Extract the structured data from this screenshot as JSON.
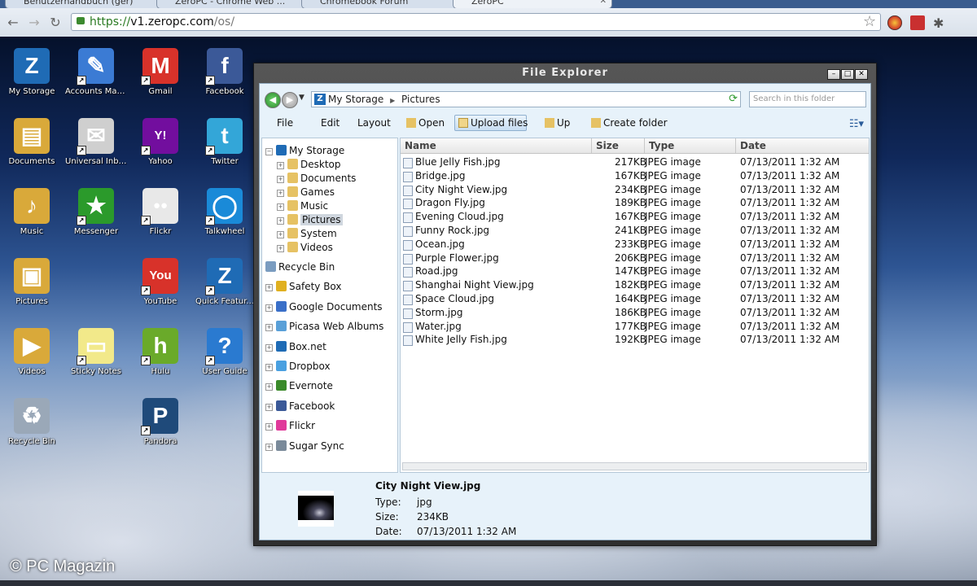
{
  "browser": {
    "tabs": [
      {
        "label": "Benutzerhandbuch (ger)"
      },
      {
        "label": "ZeroPC - Chrome Web ..."
      },
      {
        "label": "Chromebook Forum"
      },
      {
        "label": "ZeroPC"
      }
    ],
    "url_scheme": "https://",
    "url_host": "v1.zeropc.com",
    "url_path": "/os/"
  },
  "desktop_icons": [
    {
      "label": "My Storage",
      "glyph": "Z",
      "color": "#1f6bb5"
    },
    {
      "label": "Accounts Man...",
      "glyph": "✎",
      "color": "#3b7bd4"
    },
    {
      "label": "Gmail",
      "glyph": "M",
      "color": "#d8322a"
    },
    {
      "label": "Facebook",
      "glyph": "f",
      "color": "#3b5998"
    },
    {
      "label": "Documents",
      "glyph": "▤",
      "color": "#d9a93a"
    },
    {
      "label": "Universal Inbox",
      "glyph": "✉",
      "color": "#cfcfcf"
    },
    {
      "label": "Yahoo",
      "glyph": "Y!",
      "color": "#720e9e"
    },
    {
      "label": "Twitter",
      "glyph": "t",
      "color": "#33a6d8"
    },
    {
      "label": "Music",
      "glyph": "♪",
      "color": "#d9a93a"
    },
    {
      "label": "Messenger",
      "glyph": "★",
      "color": "#2b9a2b"
    },
    {
      "label": "Flickr",
      "glyph": "●●",
      "color": "#e8e8e8"
    },
    {
      "label": "Talkwheel",
      "glyph": "◯",
      "color": "#1a8ad8"
    },
    {
      "label": "Pictures",
      "glyph": "▣",
      "color": "#d9a93a"
    },
    {
      "label": "YouTube",
      "glyph": "You",
      "color": "#d8322a"
    },
    {
      "label": "Quick Featur...",
      "glyph": "Z",
      "color": "#1f6bb5"
    },
    {
      "label": "Videos",
      "glyph": "▶",
      "color": "#d9a93a"
    },
    {
      "label": "Sticky Notes",
      "glyph": "▭",
      "color": "#f2e98a"
    },
    {
      "label": "Hulu",
      "glyph": "h",
      "color": "#6aaa2a"
    },
    {
      "label": "User Guide",
      "glyph": "?",
      "color": "#2a7ad0"
    },
    {
      "label": "Recycle Bin",
      "glyph": "♻",
      "color": "#9aa8b8"
    },
    {
      "label": "Pandora",
      "glyph": "P",
      "color": "#1f4a7a"
    }
  ],
  "watermark": "© PC Magazin",
  "explorer": {
    "title": "File Explorer",
    "breadcrumb": [
      "My Storage",
      "Pictures"
    ],
    "search_placeholder": "Search in this folder",
    "menu": {
      "file": "File",
      "edit": "Edit",
      "layout": "Layout",
      "open": "Open",
      "upload": "Upload files",
      "up": "Up",
      "create_folder": "Create folder"
    },
    "tree": {
      "root": "My Storage",
      "children": [
        "Desktop",
        "Documents",
        "Games",
        "Music",
        "Pictures",
        "System",
        "Videos"
      ],
      "selected": "Pictures",
      "others": [
        {
          "label": "Recycle Bin",
          "color": "#7a9cc0"
        },
        {
          "label": "Safety Box",
          "color": "#e0b020"
        },
        {
          "label": "Google Documents",
          "color": "#3a6fc8"
        },
        {
          "label": "Picasa Web Albums",
          "color": "#5aa0d8"
        },
        {
          "label": "Box.net",
          "color": "#1f6bb5"
        },
        {
          "label": "Dropbox",
          "color": "#4aa0e0"
        },
        {
          "label": "Evernote",
          "color": "#3a8a2a"
        },
        {
          "label": "Facebook",
          "color": "#3b5998"
        },
        {
          "label": "Flickr",
          "color": "#e03a9a"
        },
        {
          "label": "Sugar Sync",
          "color": "#7a8a9a"
        }
      ]
    },
    "columns": {
      "name": "Name",
      "size": "Size",
      "type": "Type",
      "date": "Date"
    },
    "files": [
      {
        "name": "Blue Jelly Fish.jpg",
        "size": "217KB",
        "type": "JPEG image",
        "date": "07/13/2011 1:32 AM"
      },
      {
        "name": "Bridge.jpg",
        "size": "167KB",
        "type": "JPEG image",
        "date": "07/13/2011 1:32 AM"
      },
      {
        "name": "City Night View.jpg",
        "size": "234KB",
        "type": "JPEG image",
        "date": "07/13/2011 1:32 AM"
      },
      {
        "name": "Dragon Fly.jpg",
        "size": "189KB",
        "type": "JPEG image",
        "date": "07/13/2011 1:32 AM"
      },
      {
        "name": "Evening Cloud.jpg",
        "size": "167KB",
        "type": "JPEG image",
        "date": "07/13/2011 1:32 AM"
      },
      {
        "name": "Funny Rock.jpg",
        "size": "241KB",
        "type": "JPEG image",
        "date": "07/13/2011 1:32 AM"
      },
      {
        "name": "Ocean.jpg",
        "size": "233KB",
        "type": "JPEG image",
        "date": "07/13/2011 1:32 AM"
      },
      {
        "name": "Purple Flower.jpg",
        "size": "206KB",
        "type": "JPEG image",
        "date": "07/13/2011 1:32 AM"
      },
      {
        "name": "Road.jpg",
        "size": "147KB",
        "type": "JPEG image",
        "date": "07/13/2011 1:32 AM"
      },
      {
        "name": "Shanghai Night View.jpg",
        "size": "182KB",
        "type": "JPEG image",
        "date": "07/13/2011 1:32 AM"
      },
      {
        "name": "Space Cloud.jpg",
        "size": "164KB",
        "type": "JPEG image",
        "date": "07/13/2011 1:32 AM"
      },
      {
        "name": "Storm.jpg",
        "size": "186KB",
        "type": "JPEG image",
        "date": "07/13/2011 1:32 AM"
      },
      {
        "name": "Water.jpg",
        "size": "177KB",
        "type": "JPEG image",
        "date": "07/13/2011 1:32 AM"
      },
      {
        "name": "White Jelly Fish.jpg",
        "size": "192KB",
        "type": "JPEG image",
        "date": "07/13/2011 1:32 AM"
      }
    ],
    "details": {
      "name": "City Night View.jpg",
      "type_label": "Type:",
      "type_value": "jpg",
      "size_label": "Size:",
      "size_value": "234KB",
      "date_label": "Date:",
      "date_value": "07/13/2011 1:32 AM"
    }
  }
}
